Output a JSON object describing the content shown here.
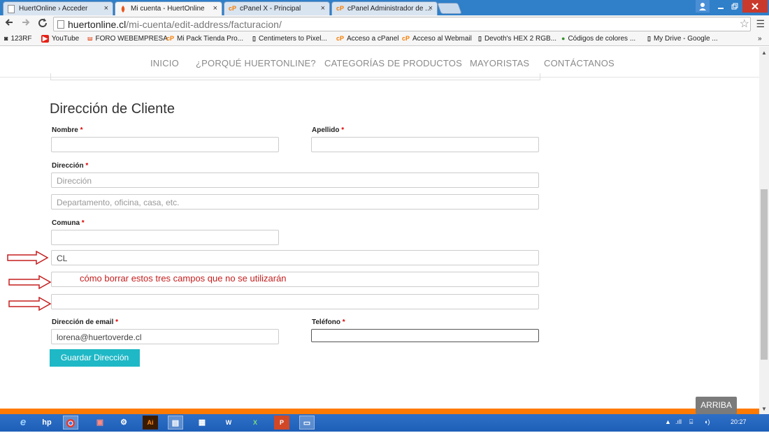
{
  "browser": {
    "tabs": [
      {
        "label": "HuertOnline › Acceder",
        "icon": "page-icon"
      },
      {
        "label": "Mi cuenta - HuertOnline",
        "icon": "huertonline-icon"
      },
      {
        "label": "cPanel X - Principal",
        "icon": "cpanel-icon"
      },
      {
        "label": "cPanel Administrador de ...",
        "icon": "cpanel-icon"
      }
    ],
    "tab_close": "×",
    "url_domain": "huertonline.cl",
    "url_path": "/mi-cuenta/edit-address/facturacion/",
    "bookmarks": [
      {
        "label": "123RF",
        "icon": "person-icon"
      },
      {
        "label": "YouTube",
        "icon": "youtube-icon"
      },
      {
        "label": "FORO WEBEMPRESA",
        "icon": "webempresa-icon"
      },
      {
        "label": "Mi Pack Tienda Pro...",
        "icon": "cpanel-icon"
      },
      {
        "label": "Centimeters to Pixel...",
        "icon": "page-icon"
      },
      {
        "label": "Acceso a cPanel",
        "icon": "cpanel-icon"
      },
      {
        "label": "Acceso al Webmail",
        "icon": "cpanel-icon"
      },
      {
        "label": "Devoth's HEX 2 RGB...",
        "icon": "page-icon"
      },
      {
        "label": "Códigos de colores ...",
        "icon": "color-icon"
      },
      {
        "label": "My Drive - Google ...",
        "icon": "page-icon"
      }
    ],
    "bookmarks_more": "»"
  },
  "site_nav": [
    "INICIO",
    "¿PORQUÉ HUERTONLINE?",
    "CATEGORÍAS DE PRODUCTOS",
    "MAYORISTAS",
    "CONTÁCTANOS"
  ],
  "form": {
    "heading": "Dirección de Cliente",
    "nombre_label": "Nombre",
    "apellido_label": "Apellido",
    "direccion_label": "Dirección",
    "direccion_placeholder": "Dirección",
    "direccion2_placeholder": "Departamento, oficina, casa, etc.",
    "comuna_label": "Comuna",
    "country_value": "CL",
    "email_label": "Dirección de email",
    "email_value": "lorena@huertoverde.cl",
    "telefono_label": "Teléfono",
    "required_mark": "*",
    "save_label": "Guardar Dirección"
  },
  "annotation": {
    "note": "cómo borrar estos tres campos que no se utilizarán",
    "arrow_color": "#c51e1e"
  },
  "back_to_top": "ARRIBA",
  "taskbar": {
    "time": "20:27"
  },
  "colors": {
    "accent": "#1fb8c6",
    "footer_bar": "#ff7a00",
    "required": "#dd0000"
  }
}
